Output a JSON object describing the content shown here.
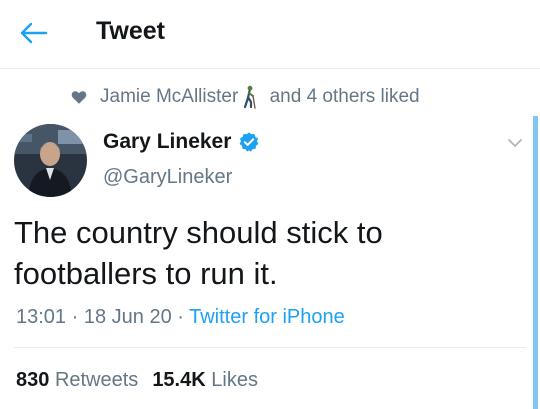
{
  "header": {
    "title": "Tweet",
    "back_icon": "arrow-left-icon"
  },
  "social_context": {
    "icon": "heart-icon",
    "user": "Jamie McAllister",
    "user_emoji": "person-walking-with-cane-icon",
    "suffix": "and 4 others liked"
  },
  "tweet": {
    "author_name": "Gary Lineker",
    "author_handle": "@GaryLineker",
    "verified_icon": "verified-badge-icon",
    "menu_icon": "chevron-down-icon",
    "text": "The country should stick to footballers to run it.",
    "time": "13:01",
    "separator": " · ",
    "date": "18 Jun 20",
    "source": "Twitter for iPhone"
  },
  "stats": {
    "retweets_count": "830",
    "retweets_label": "Retweets",
    "likes_count": "15.4K",
    "likes_label": "Likes"
  },
  "colors": {
    "accent": "#1da1f2",
    "secondary_text": "#657786",
    "primary_text": "#14171a",
    "divider": "#e6ecf0"
  }
}
